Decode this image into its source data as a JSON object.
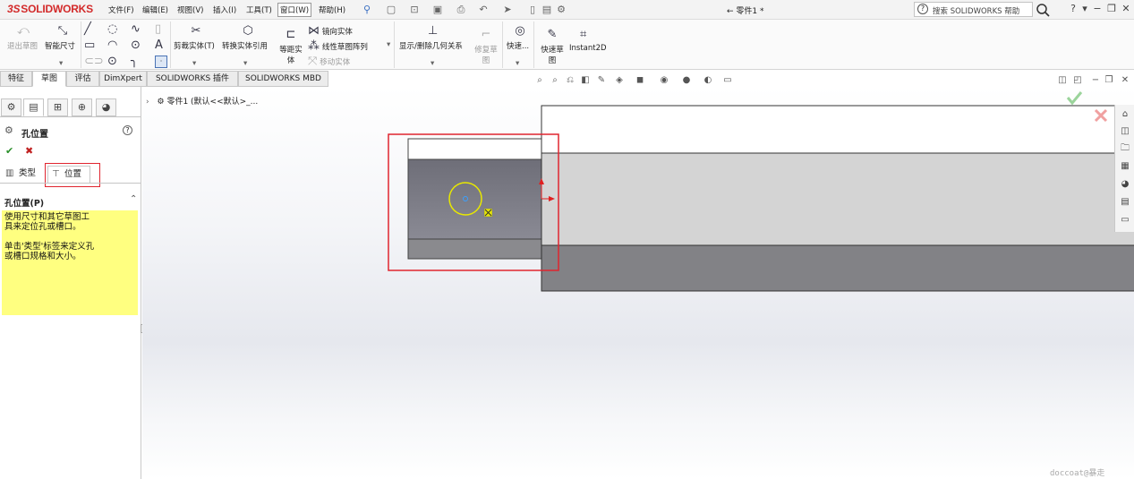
{
  "app": {
    "logo_prefix": "3S",
    "logo_text": "SOLIDWORKS",
    "document_title": "← 零件1 *"
  },
  "menu": {
    "items": [
      "文件(F)",
      "编辑(E)",
      "视图(V)",
      "插入(I)",
      "工具(T)",
      "窗口(W)",
      "帮助(H)"
    ],
    "active": "窗口(W)"
  },
  "search": {
    "placeholder": "搜索 SOLIDWORKS 帮助"
  },
  "ribbon": {
    "exit_sketch": "退出草图",
    "smart_dimension": "智能尺寸",
    "trim_entities": "剪裁实体(T)",
    "convert_entities": "转换实体引用",
    "offset_entities": "等距实",
    "offset_entities_2": "体",
    "mirror_entities": "镜向实体",
    "linear_pattern": "线性草图阵列",
    "move_entities": "移动实体",
    "display_relations": "显示/删除几何关系",
    "repair_sketch": "修复草",
    "repair_sketch_2": "图",
    "quick_snaps": "快速...",
    "rapid_sketch": "快速草",
    "rapid_sketch_2": "图",
    "instant2d": "Instant2D"
  },
  "command_tabs": [
    "特征",
    "草图",
    "评估",
    "DimXpert",
    "SOLIDWORKS 插件",
    "SOLIDWORKS MBD"
  ],
  "active_command_tab": "草图",
  "feature_tree": {
    "root": "零件1 (默认<<默认>_..."
  },
  "property_manager": {
    "title": "孔位置",
    "tabs": {
      "type": "类型",
      "position": "位置"
    },
    "active_tab": "位置",
    "section_title": "孔位置(P)",
    "message_line1": "使用尺寸和其它草图工",
    "message_line2": "具来定位孔或槽口。",
    "message_line3": "单击'类型'标签来定义孔",
    "message_line4": "或槽口规格和大小。"
  },
  "watermark": "doccoat@暴走",
  "colors": {
    "highlight_red": "#e0252f",
    "message_yellow": "#ffff80",
    "face_dark": "#7b7b83",
    "face_light": "#d4d4d4",
    "hole_yellow": "#e8e800"
  }
}
